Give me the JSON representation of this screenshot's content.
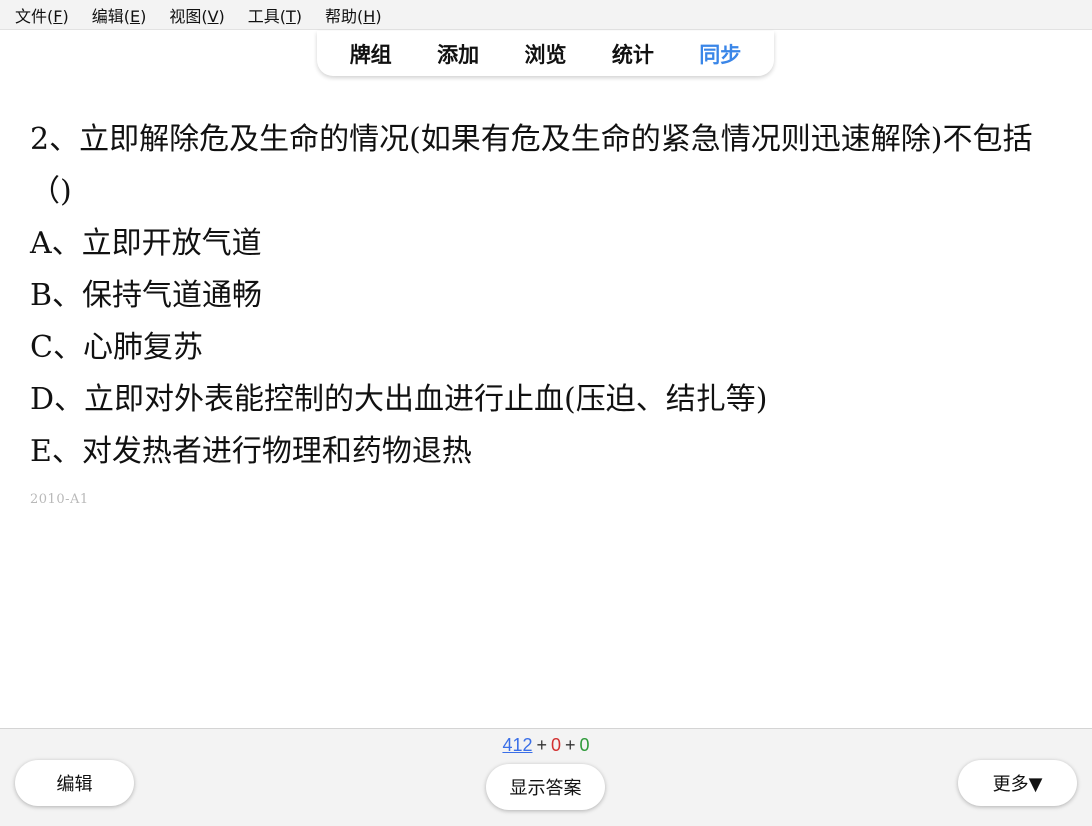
{
  "menu": {
    "items": [
      {
        "label": "文件(",
        "mnemonic": "F",
        "suffix": ")"
      },
      {
        "label": "编辑(",
        "mnemonic": "E",
        "suffix": ")"
      },
      {
        "label": "视图(",
        "mnemonic": "V",
        "suffix": ")"
      },
      {
        "label": "工具(",
        "mnemonic": "T",
        "suffix": ")"
      },
      {
        "label": "帮助(",
        "mnemonic": "H",
        "suffix": ")"
      }
    ]
  },
  "toolbar": {
    "decks": "牌组",
    "add": "添加",
    "browse": "浏览",
    "stats": "统计",
    "sync": "同步",
    "accent_color": "#3a86e8"
  },
  "card": {
    "question": "2、立即解除危及生命的情况(如果有危及生命的紧急情况则迅速解除)不包括（)",
    "options": [
      "A、立即开放气道",
      "B、保持气道通畅",
      "C、心肺复苏",
      "D、立即对外表能控制的大出血进行止血(压迫、结扎等)",
      "E、对发热者进行物理和药物退热"
    ],
    "tag": "2010-A1"
  },
  "bottom": {
    "count_new": "412",
    "count_learn": "0",
    "count_review": "0",
    "plus": "+",
    "edit_label": "编辑",
    "show_answer_label": "显示答案",
    "more_label": "更多▼"
  }
}
